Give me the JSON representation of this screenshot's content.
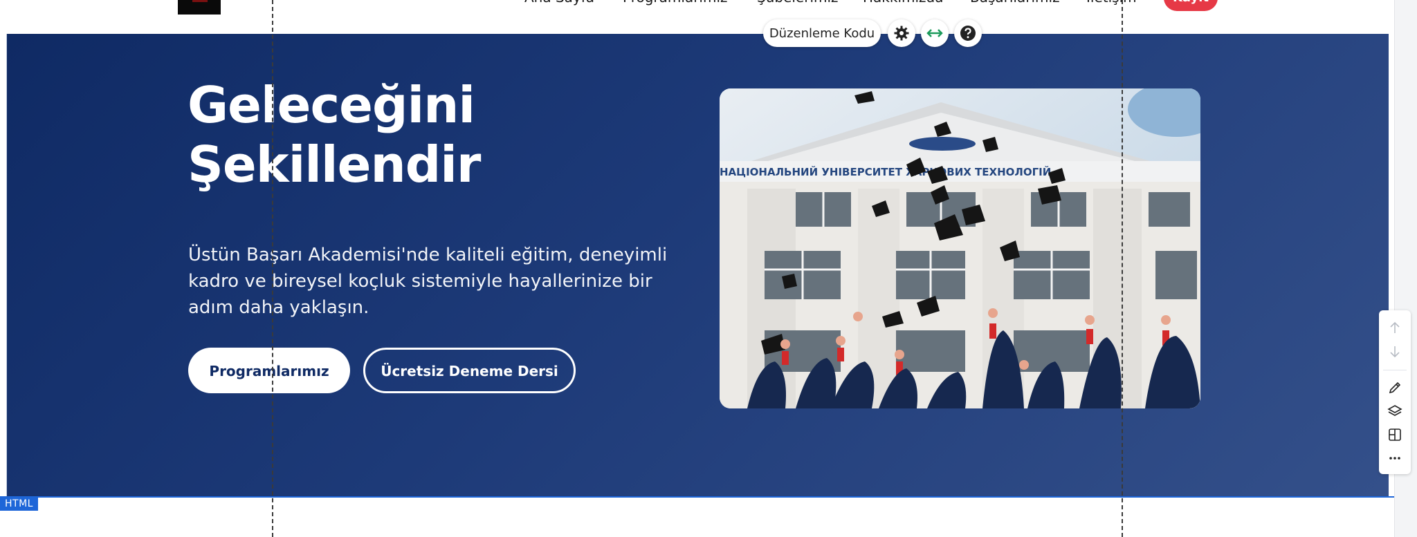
{
  "header": {
    "nav_items": [
      "Ana Sayfa",
      "Programlarımız",
      "Şubelerimiz",
      "Hakkımızda",
      "Başarılarımız",
      "İletişim"
    ],
    "cta_label": "Kayıt",
    "cta_color": "#e63946"
  },
  "hero": {
    "title_line1": "Geleceğini",
    "title_line2": "Şekillendir",
    "description": "Üstün Başarı Akademisi'nde kaliteli eğitim, deneyimli kadro ve bireysel koçluk sistemiyle hayallerinize bir adım daha yaklaşın.",
    "primary_button": "Programlarımız",
    "secondary_button": "Ücretsiz Deneme Dersi",
    "image_subject": "graduation caps thrown in front of university building",
    "building_sign": "НАЦІОНАЛЬНИЙ УНІВЕРСИТЕТ ХАРЧОВИХ ТЕХНОЛОГІЙ",
    "background_color": "#1d3a78"
  },
  "editor": {
    "edit_code_label": "Düzenleme Kodu",
    "tools": [
      "gear-icon",
      "stretch-arrows-icon",
      "help-icon"
    ],
    "side_tools": [
      "arrow-up-icon",
      "arrow-down-icon",
      "pencil-icon",
      "layers-icon",
      "layout-icon",
      "more-icon"
    ],
    "element_tag": "HTML",
    "selection_color": "#1e66d8"
  }
}
